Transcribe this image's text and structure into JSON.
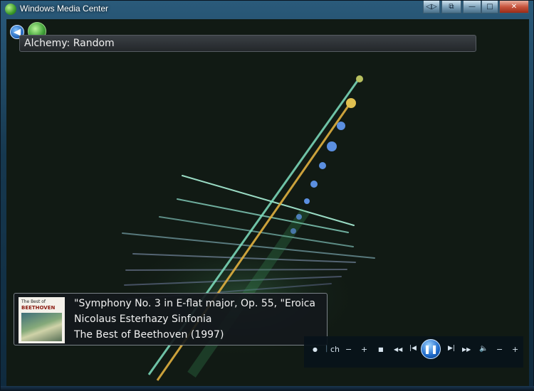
{
  "window": {
    "title": "Windows Media Center"
  },
  "titlebar_buttons": {
    "toggle_icon": "◁▷",
    "restore_icon": "⧉",
    "minimize_icon": "—",
    "maximize_icon": "□",
    "close_icon": "✕"
  },
  "header": {
    "title": "Alchemy: Random"
  },
  "nav": {
    "back_icon": "back-arrow-icon",
    "logo_icon": "start-logo-icon"
  },
  "now_playing": {
    "track": "\"Symphony No. 3 in E-flat major, Op. 55, \"Eroica",
    "artist": "Nicolaus Esterhazy Sinfonia",
    "album": "The Best of Beethoven (1997)",
    "cover": {
      "label": "The Best of",
      "title": "BEETHOVEN"
    }
  },
  "transport": {
    "dot": "●",
    "ch": "ch",
    "ch_minus": "−",
    "ch_plus": "+",
    "stop": "■",
    "rewind": "◀◀",
    "prev": "|◀",
    "play_pause": "❚❚",
    "next": "▶|",
    "ffwd": "▶▶",
    "volume": "🔈",
    "vol_minus": "−",
    "vol_plus": "+"
  },
  "colors": {
    "viz_bg": "#111a14",
    "line_cyan": "#8fe8c8",
    "line_yellow": "#e5b640",
    "dots": "#5b8fe0"
  }
}
